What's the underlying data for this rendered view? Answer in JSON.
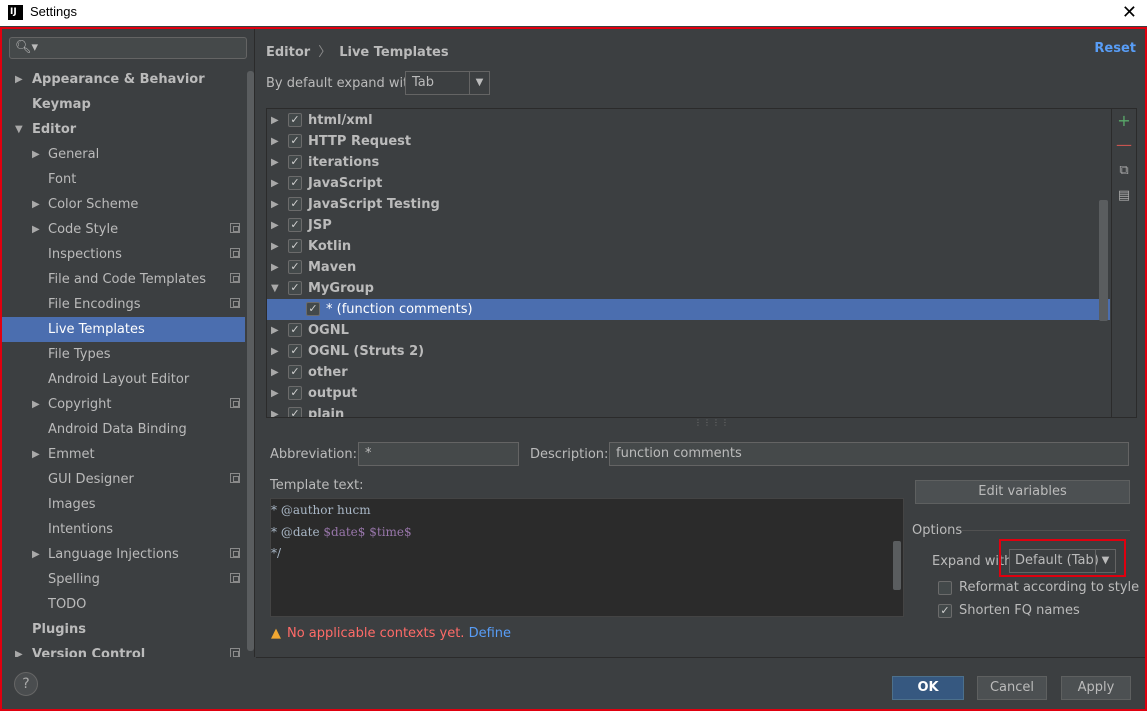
{
  "window": {
    "title": "Settings",
    "app_icon": "IJ"
  },
  "search": {
    "placeholder": ""
  },
  "sidebar": {
    "items": [
      {
        "label": "Appearance & Behavior",
        "level": 0,
        "arrow": "right"
      },
      {
        "label": "Keymap",
        "level": 0,
        "arrow": ""
      },
      {
        "label": "Editor",
        "level": 0,
        "arrow": "down"
      },
      {
        "label": "General",
        "level": 1,
        "arrow": "right"
      },
      {
        "label": "Font",
        "level": 1,
        "arrow": ""
      },
      {
        "label": "Color Scheme",
        "level": 1,
        "arrow": "right"
      },
      {
        "label": "Code Style",
        "level": 1,
        "arrow": "right",
        "project": true
      },
      {
        "label": "Inspections",
        "level": 1,
        "arrow": "",
        "project": true
      },
      {
        "label": "File and Code Templates",
        "level": 1,
        "arrow": "",
        "project": true
      },
      {
        "label": "File Encodings",
        "level": 1,
        "arrow": "",
        "project": true
      },
      {
        "label": "Live Templates",
        "level": 1,
        "arrow": "",
        "selected": true
      },
      {
        "label": "File Types",
        "level": 1,
        "arrow": ""
      },
      {
        "label": "Android Layout Editor",
        "level": 1,
        "arrow": ""
      },
      {
        "label": "Copyright",
        "level": 1,
        "arrow": "right",
        "project": true
      },
      {
        "label": "Android Data Binding",
        "level": 1,
        "arrow": ""
      },
      {
        "label": "Emmet",
        "level": 1,
        "arrow": "right"
      },
      {
        "label": "GUI Designer",
        "level": 1,
        "arrow": "",
        "project": true
      },
      {
        "label": "Images",
        "level": 1,
        "arrow": ""
      },
      {
        "label": "Intentions",
        "level": 1,
        "arrow": ""
      },
      {
        "label": "Language Injections",
        "level": 1,
        "arrow": "right",
        "project": true
      },
      {
        "label": "Spelling",
        "level": 1,
        "arrow": "",
        "project": true
      },
      {
        "label": "TODO",
        "level": 1,
        "arrow": ""
      },
      {
        "label": "Plugins",
        "level": 0,
        "arrow": ""
      },
      {
        "label": "Version Control",
        "level": 0,
        "arrow": "right",
        "project": true
      }
    ]
  },
  "breadcrumb": {
    "parent": "Editor",
    "separator": "〉",
    "current": "Live Templates"
  },
  "reset_label": "Reset",
  "expand_default": {
    "label": "By default expand with",
    "value": "Tab"
  },
  "template_groups": [
    {
      "label": "html/xml",
      "checked": true,
      "expanded": false
    },
    {
      "label": "HTTP Request",
      "checked": true,
      "expanded": false
    },
    {
      "label": "iterations",
      "checked": true,
      "expanded": false
    },
    {
      "label": "JavaScript",
      "checked": true,
      "expanded": false
    },
    {
      "label": "JavaScript Testing",
      "checked": true,
      "expanded": false
    },
    {
      "label": "JSP",
      "checked": true,
      "expanded": false
    },
    {
      "label": "Kotlin",
      "checked": true,
      "expanded": false
    },
    {
      "label": "Maven",
      "checked": true,
      "expanded": false
    },
    {
      "label": "MyGroup",
      "checked": true,
      "expanded": true
    },
    {
      "label": "* (function comments)",
      "checked": true,
      "child": true,
      "selected": true
    },
    {
      "label": "OGNL",
      "checked": true,
      "expanded": false
    },
    {
      "label": "OGNL (Struts 2)",
      "checked": true,
      "expanded": false
    },
    {
      "label": "other",
      "checked": true,
      "expanded": false
    },
    {
      "label": "output",
      "checked": true,
      "expanded": false
    },
    {
      "label": "plain",
      "checked": true,
      "expanded": false
    }
  ],
  "toolbar_icons": [
    "plus-icon",
    "minus-icon",
    "copy-icon",
    "restore-icon"
  ],
  "abbreviation": {
    "label": "Abbreviation:",
    "value": "*"
  },
  "description": {
    "label": "Description:",
    "value": "function comments"
  },
  "template_text": {
    "label": "Template text:",
    "lines": [
      [
        {
          "t": "* @author hucm"
        }
      ],
      [
        {
          "t": "* @date "
        },
        {
          "t": "$date$",
          "var": true
        },
        {
          "t": " "
        },
        {
          "t": "$time$",
          "var": true
        }
      ],
      [
        {
          "t": "*/"
        }
      ]
    ]
  },
  "edit_variables_label": "Edit variables",
  "options": {
    "label": "Options",
    "expand_with_label": "Expand with",
    "expand_with_value": "Default (Tab)",
    "reformat_label": "Reformat according to style",
    "reformat_checked": false,
    "shorten_label": "Shorten FQ names",
    "shorten_checked": true
  },
  "warning": {
    "text": "No applicable contexts yet.",
    "link": "Define"
  },
  "buttons": {
    "ok": "OK",
    "cancel": "Cancel",
    "apply": "Apply"
  },
  "help_label": "?",
  "colors": {
    "accent": "#4b6eaf",
    "link": "#589df6",
    "highlight_border": "#e0000f",
    "warning": "#ff6b68"
  }
}
